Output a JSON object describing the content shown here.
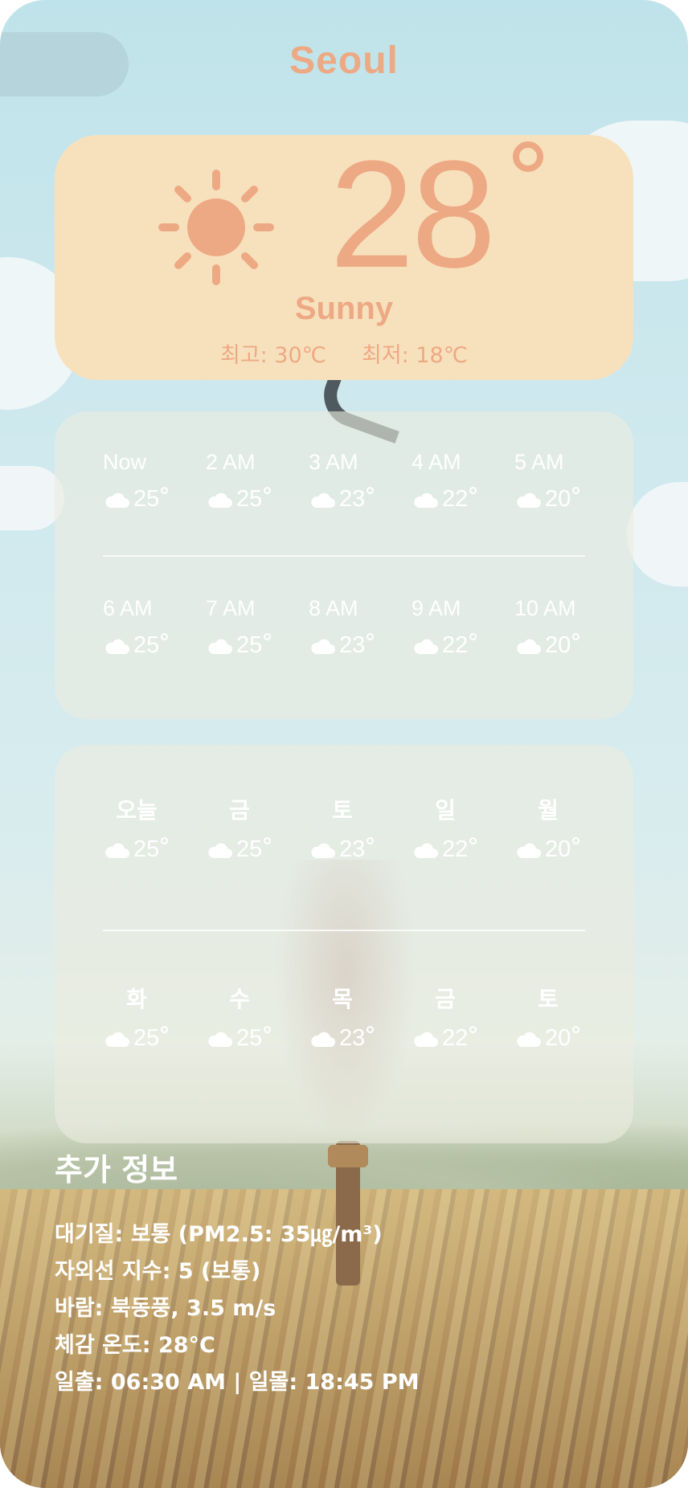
{
  "city": "Seoul",
  "current": {
    "temp": "28",
    "condition": "Sunny",
    "high": "최고: 30℃",
    "low": "최저:  18℃",
    "icon": "sun-icon"
  },
  "colors": {
    "accent": "#eda984",
    "hero_bg": "#f7e1bd",
    "panel_text": "#ffffff"
  },
  "hourly": [
    {
      "label": "Now",
      "temp": "25",
      "icon": "cloud-icon"
    },
    {
      "label": "2 AM",
      "temp": "25",
      "icon": "cloud-icon"
    },
    {
      "label": "3 AM",
      "temp": "23",
      "icon": "cloud-icon"
    },
    {
      "label": "4 AM",
      "temp": "22",
      "icon": "cloud-icon"
    },
    {
      "label": "5 AM",
      "temp": "20",
      "icon": "cloud-icon"
    },
    {
      "label": "6 AM",
      "temp": "25",
      "icon": "cloud-icon"
    },
    {
      "label": "7 AM",
      "temp": "25",
      "icon": "cloud-icon"
    },
    {
      "label": "8 AM",
      "temp": "23",
      "icon": "cloud-icon"
    },
    {
      "label": "9 AM",
      "temp": "22",
      "icon": "cloud-icon"
    },
    {
      "label": "10 AM",
      "temp": "20",
      "icon": "cloud-icon"
    }
  ],
  "daily": [
    {
      "label": "오늘",
      "temp": "25",
      "icon": "cloud-icon"
    },
    {
      "label": "금",
      "temp": "25",
      "icon": "cloud-icon"
    },
    {
      "label": "토",
      "temp": "23",
      "icon": "cloud-icon"
    },
    {
      "label": "일",
      "temp": "22",
      "icon": "cloud-icon"
    },
    {
      "label": "월",
      "temp": "20",
      "icon": "cloud-icon"
    },
    {
      "label": "화",
      "temp": "25",
      "icon": "cloud-icon"
    },
    {
      "label": "수",
      "temp": "25",
      "icon": "cloud-icon"
    },
    {
      "label": "목",
      "temp": "23",
      "icon": "cloud-icon"
    },
    {
      "label": "금",
      "temp": "22",
      "icon": "cloud-icon"
    },
    {
      "label": "토",
      "temp": "20",
      "icon": "cloud-icon"
    }
  ],
  "extra": {
    "title": "추가 정보",
    "air_quality": "대기질: 보통 (PM2.5: 35㎍/m³)",
    "uv": "자외선 지수: 5 (보통)",
    "wind": "바람: 북동풍, 3.5 m/s",
    "feels_like": "체감 온도: 28°C",
    "sun": "일출: 06:30 AM | 일몰: 18:45 PM"
  }
}
